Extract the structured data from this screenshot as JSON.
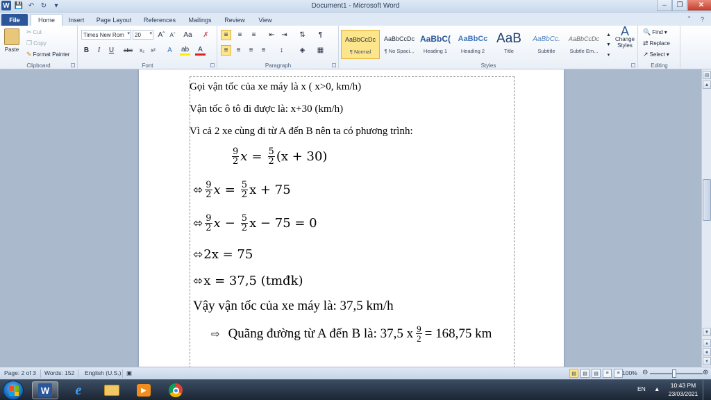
{
  "window": {
    "title": "Document1 - Microsoft Word",
    "app_letter": "W"
  },
  "tabs": [
    "File",
    "Home",
    "Insert",
    "Page Layout",
    "References",
    "Mailings",
    "Review",
    "View"
  ],
  "ribbon": {
    "clipboard": {
      "paste": "Paste",
      "cut": "Cut",
      "copy": "Copy",
      "format_painter": "Format Painter",
      "label": "Clipboard"
    },
    "font": {
      "family": "Times New Rom",
      "size": "20",
      "label": "Font"
    },
    "paragraph": {
      "label": "Paragraph"
    },
    "styles": {
      "label": "Styles",
      "items": [
        {
          "preview": "AaBbCcDc",
          "name": "¶ Normal"
        },
        {
          "preview": "AaBbCcDc",
          "name": "¶ No Spaci..."
        },
        {
          "preview": "AaBbC(",
          "name": "Heading 1"
        },
        {
          "preview": "AaBbCc",
          "name": "Heading 2"
        },
        {
          "preview": "AaB",
          "name": "Title"
        },
        {
          "preview": "AaBbCc.",
          "name": "Subtitle"
        },
        {
          "preview": "AaBbCcDc",
          "name": "Subtle Em..."
        }
      ],
      "change_styles": "Change Styles"
    },
    "editing": {
      "find": "Find",
      "replace": "Replace",
      "select": "Select",
      "label": "Editing"
    }
  },
  "document": {
    "line1": "Gọi vận tốc của xe máy là x ( x>0, km/h)",
    "line2": "Vận tốc ô tô đi được là: x+30 (km/h)",
    "line3": "Vì cả 2 xe cùng đi từ A đến B nên ta có phương trình:",
    "eq1": {
      "n1": "9",
      "d1": "2",
      "var": "x",
      "eq": "=",
      "n2": "5",
      "d2": "2",
      "rhs": "(x + 30)"
    },
    "eq2": {
      "arrow": "⬄",
      "n1": "9",
      "d1": "2",
      "var": "x",
      "eq": "=",
      "n2": "5",
      "d2": "2",
      "rhs": "x + 75"
    },
    "eq3": {
      "arrow": "⬄",
      "n1": "9",
      "d1": "2",
      "var": "x",
      "minus": "−",
      "n2": "5",
      "d2": "2",
      "rhs": "x − 75 = 0"
    },
    "eq4": {
      "arrow": "⬄",
      "text": "2x = 75"
    },
    "eq5": {
      "arrow": "⬄",
      "text": "x = 37,5 (tmđk)"
    },
    "line4": "Vậy vận tốc của xe máy là: 37,5 km/h",
    "line5": {
      "arrow": "⇨",
      "before": "Quãng đường từ A đến B là: 37,5 x",
      "n": "9",
      "d": "2",
      "after": "= 168,75 km"
    }
  },
  "statusbar": {
    "page": "Page: 2 of 3",
    "words": "Words: 152",
    "language": "English (U.S.)",
    "zoom": "100%"
  },
  "taskbar": {
    "lang": "EN",
    "time": "10:43 PM",
    "date": "23/03/2021"
  }
}
